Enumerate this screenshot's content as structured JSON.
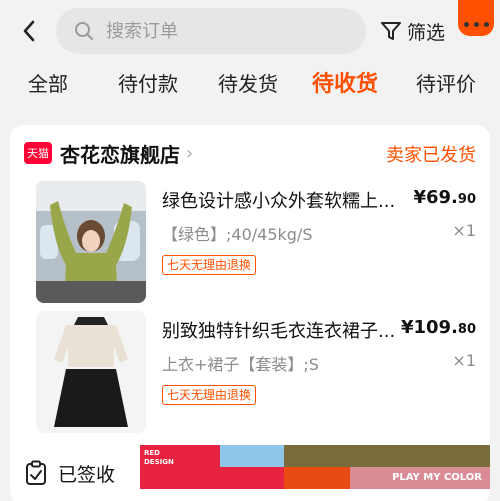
{
  "header": {
    "search_placeholder": "搜索订单",
    "filter_label": "筛选"
  },
  "tabs": [
    {
      "label": "全部"
    },
    {
      "label": "待付款"
    },
    {
      "label": "待发货"
    },
    {
      "label": "待收货",
      "active": true
    },
    {
      "label": "待评价"
    }
  ],
  "order": {
    "shop_badge": "天猫",
    "shop_name": "杏花恋旗舰店",
    "status": "卖家已发货",
    "items": [
      {
        "title": "绿色设计感小众外套软糯上...",
        "price_main": "¥69.",
        "price_cents": "90",
        "sku": "【绿色】;40/45kg/S",
        "qty": "×1",
        "tag": "七天无理由退换"
      },
      {
        "title": "别致独特针织毛衣连衣裙子...",
        "price_main": "¥109.",
        "price_cents": "80",
        "sku": "上衣+裙子【套装】;S",
        "qty": "×1",
        "tag": "七天无理由退换"
      }
    ],
    "delivery_status": "已签收"
  },
  "ad": {
    "line1": "RED",
    "line2": "DESIGN",
    "slogan": "PLAY MY COLOR"
  },
  "colors": {
    "accent": "#ff5000",
    "tmall_red": "#ff0036"
  }
}
